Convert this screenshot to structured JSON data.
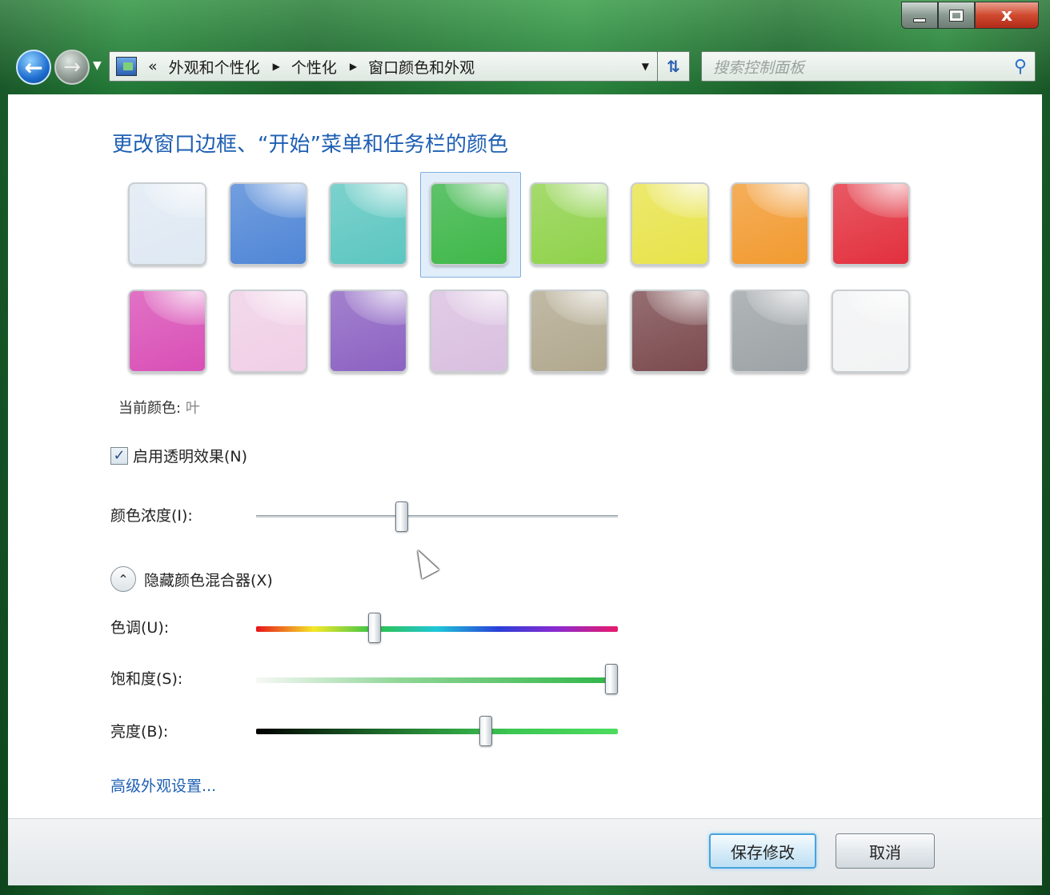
{
  "window": {
    "caption": {
      "minimize": "minimize",
      "maximize": "maximize",
      "close": "x"
    }
  },
  "nav": {
    "address_prefix": "«",
    "breadcrumb": [
      "外观和个性化",
      "个性化",
      "窗口颜色和外观"
    ],
    "search_placeholder": "搜索控制面板"
  },
  "main": {
    "title": "更改窗口边框、“开始”菜单和任务栏的颜色",
    "swatches": [
      {
        "color": "#dfe9f3"
      },
      {
        "color": "#4f86d6"
      },
      {
        "color": "#5cc6c0"
      },
      {
        "color": "#3fb848",
        "selected": true
      },
      {
        "color": "#8fd24a"
      },
      {
        "color": "#e8e34a"
      },
      {
        "color": "#f29a30"
      },
      {
        "color": "#e2303d"
      },
      {
        "color": "#d94fb6"
      },
      {
        "color": "#f0cfe6"
      },
      {
        "color": "#8c62c2"
      },
      {
        "color": "#d9bfe0"
      },
      {
        "color": "#b1a88e"
      },
      {
        "color": "#7b4a4e"
      },
      {
        "color": "#9da3a6"
      },
      {
        "color": "#f2f3f4"
      }
    ],
    "current_color_label": "当前颜色:",
    "current_color_value": "叶",
    "transparency_label": "启用透明效果(N)",
    "transparency_checked": true,
    "intensity_label": "颜色浓度(I):",
    "intensity_value": 0.4,
    "mixer_label": "隐藏颜色混合器(X)",
    "hue_label": "色调(U):",
    "hue_value": 0.32,
    "saturation_label": "饱和度(S):",
    "saturation_value": 1.0,
    "brightness_label": "亮度(B):",
    "brightness_value": 0.64,
    "advanced_link": "高级外观设置..."
  },
  "footer": {
    "save_label": "保存修改",
    "cancel_label": "取消"
  }
}
